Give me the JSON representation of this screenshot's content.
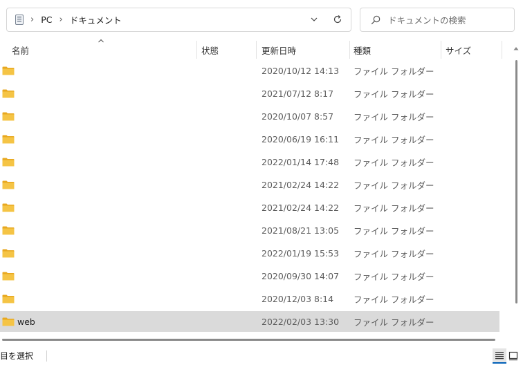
{
  "address_bar": {
    "crumbs": [
      "PC",
      "ドキュメント"
    ],
    "location_icon": "pc-icon",
    "dropdown_icon": "chevron-down-icon",
    "refresh_icon": "refresh-icon"
  },
  "search": {
    "placeholder": "ドキュメントの検索",
    "icon": "search-icon"
  },
  "columns": {
    "name": "名前",
    "status": "状態",
    "modified": "更新日時",
    "type": "種類",
    "size": "サイズ"
  },
  "rows": [
    {
      "name": "",
      "modified": "2020/10/12 14:13",
      "type": "ファイル フォルダー"
    },
    {
      "name": "",
      "modified": "2021/07/12 8:17",
      "type": "ファイル フォルダー"
    },
    {
      "name": "",
      "modified": "2020/10/07 8:57",
      "type": "ファイル フォルダー"
    },
    {
      "name": "",
      "modified": "2020/06/19 16:11",
      "type": "ファイル フォルダー"
    },
    {
      "name": "",
      "modified": "2022/01/14 17:48",
      "type": "ファイル フォルダー"
    },
    {
      "name": "",
      "modified": "2021/02/24 14:22",
      "type": "ファイル フォルダー"
    },
    {
      "name": "",
      "modified": "2021/02/24 14:22",
      "type": "ファイル フォルダー"
    },
    {
      "name": "",
      "modified": "2021/08/21 13:05",
      "type": "ファイル フォルダー"
    },
    {
      "name": "",
      "modified": "2022/01/19 15:53",
      "type": "ファイル フォルダー"
    },
    {
      "name": "",
      "modified": "2020/09/30 14:07",
      "type": "ファイル フォルダー"
    },
    {
      "name": "",
      "modified": "2020/12/03 8:14",
      "type": "ファイル フォルダー"
    },
    {
      "name": "web",
      "modified": "2022/02/03 13:30",
      "type": "ファイル フォルダー"
    }
  ],
  "status_bar": {
    "text": "項目を選択",
    "details_view_icon": "details-view-icon",
    "tiles_view_icon": "large-icons-view-icon"
  },
  "colors": {
    "folder": "#f5c445",
    "selected_row": "#dadada",
    "accent": "#005fb8"
  }
}
